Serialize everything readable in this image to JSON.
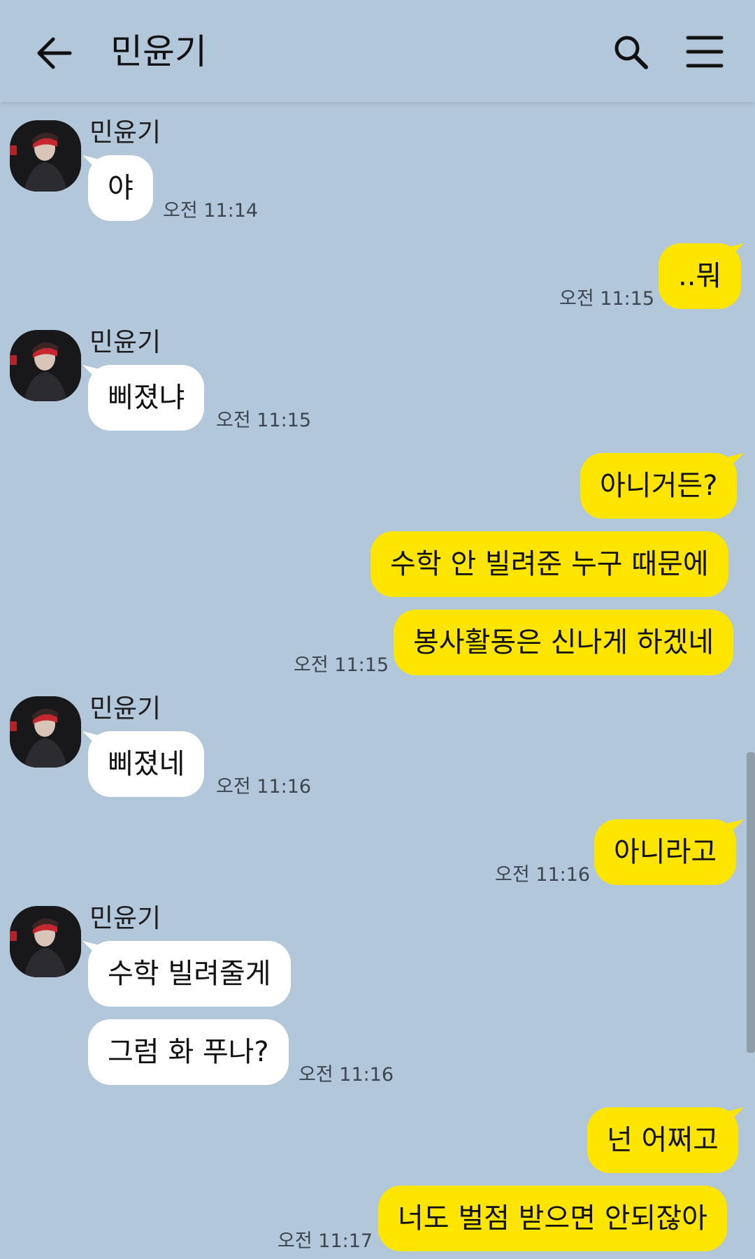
{
  "header": {
    "title": "민윤기",
    "back_icon": "arrow-left-icon",
    "search_icon": "search-icon",
    "menu_icon": "hamburger-menu-icon"
  },
  "colors": {
    "background": "#b2c7da",
    "incoming_bubble": "#ffffff",
    "outgoing_bubble": "#fee500"
  },
  "messages": [
    {
      "sender": "민윤기",
      "text": "야",
      "time": "오전 11:14"
    },
    {
      "text": "..뭐",
      "time": "오전 11:15"
    },
    {
      "sender": "민윤기",
      "text": "삐졌냐",
      "time": "오전 11:15"
    },
    {
      "text": "아니거든?"
    },
    {
      "text": "수학 안 빌려준 누구 때문에"
    },
    {
      "text": "봉사활동은 신나게 하겠네",
      "time": "오전 11:15"
    },
    {
      "sender": "민윤기",
      "text": "삐졌네",
      "time": "오전 11:16"
    },
    {
      "text": "아니라고",
      "time": "오전 11:16"
    },
    {
      "sender": "민윤기",
      "text": "수학 빌려줄게"
    },
    {
      "text": "그럼 화 푸나?",
      "time": "오전 11:16"
    },
    {
      "text": "넌 어쩌고"
    },
    {
      "text": "너도 벌점 받으면 안되잖아",
      "time": "오전 11:17"
    }
  ]
}
